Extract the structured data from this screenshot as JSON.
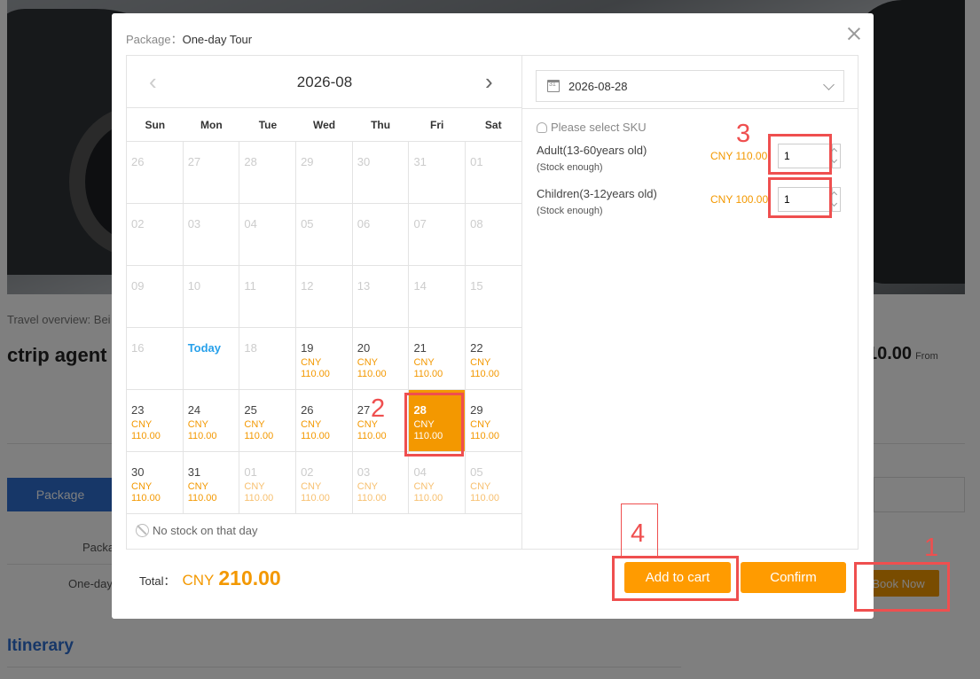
{
  "background": {
    "overview_text": "Travel overview: Bei",
    "title": "ctrip agent",
    "price": "10.00",
    "price_from": "From",
    "package_tab": "Package",
    "col_header": "Packa",
    "row_text": "One-day",
    "book_now": "Book Now",
    "itinerary": "Itinerary"
  },
  "modal": {
    "package_label": "Package：",
    "package_name": "One-day Tour",
    "calendar": {
      "month": "2026-08",
      "weekdays": [
        "Sun",
        "Mon",
        "Tue",
        "Wed",
        "Thu",
        "Fri",
        "Sat"
      ],
      "days": [
        {
          "d": "26",
          "p": ""
        },
        {
          "d": "27",
          "p": ""
        },
        {
          "d": "28",
          "p": ""
        },
        {
          "d": "29",
          "p": ""
        },
        {
          "d": "30",
          "p": ""
        },
        {
          "d": "31",
          "p": ""
        },
        {
          "d": "01",
          "p": ""
        },
        {
          "d": "02",
          "p": ""
        },
        {
          "d": "03",
          "p": ""
        },
        {
          "d": "04",
          "p": ""
        },
        {
          "d": "05",
          "p": ""
        },
        {
          "d": "06",
          "p": ""
        },
        {
          "d": "07",
          "p": ""
        },
        {
          "d": "08",
          "p": ""
        },
        {
          "d": "09",
          "p": ""
        },
        {
          "d": "10",
          "p": ""
        },
        {
          "d": "11",
          "p": ""
        },
        {
          "d": "12",
          "p": ""
        },
        {
          "d": "13",
          "p": ""
        },
        {
          "d": "14",
          "p": ""
        },
        {
          "d": "15",
          "p": ""
        },
        {
          "d": "16",
          "p": ""
        },
        {
          "d": "Today",
          "p": "",
          "state": "today"
        },
        {
          "d": "18",
          "p": ""
        },
        {
          "d": "19",
          "p": "CNY 110.00",
          "state": "avail"
        },
        {
          "d": "20",
          "p": "CNY 110.00",
          "state": "avail"
        },
        {
          "d": "21",
          "p": "CNY 110.00",
          "state": "avail"
        },
        {
          "d": "22",
          "p": "CNY 110.00",
          "state": "avail"
        },
        {
          "d": "23",
          "p": "CNY 110.00",
          "state": "avail"
        },
        {
          "d": "24",
          "p": "CNY 110.00",
          "state": "avail"
        },
        {
          "d": "25",
          "p": "CNY 110.00",
          "state": "avail"
        },
        {
          "d": "26",
          "p": "CNY 110.00",
          "state": "avail"
        },
        {
          "d": "27",
          "p": "CNY 110.00",
          "state": "avail"
        },
        {
          "d": "28",
          "p": "CNY 110.00",
          "state": "sel"
        },
        {
          "d": "29",
          "p": "CNY 110.00",
          "state": "avail"
        },
        {
          "d": "30",
          "p": "CNY 110.00",
          "state": "avail"
        },
        {
          "d": "31",
          "p": "CNY 110.00",
          "state": "avail"
        },
        {
          "d": "01",
          "p": "CNY 110.00",
          "state": "dim"
        },
        {
          "d": "02",
          "p": "CNY 110.00",
          "state": "dim"
        },
        {
          "d": "03",
          "p": "CNY 110.00",
          "state": "dim"
        },
        {
          "d": "04",
          "p": "CNY 110.00",
          "state": "dim"
        },
        {
          "d": "05",
          "p": "CNY 110.00",
          "state": "dim"
        }
      ],
      "legend": "No stock on that day"
    },
    "selected_date": "2026-08-28",
    "sku_hint": "Please select SKU",
    "skus": [
      {
        "name": "Adult(13-60years old)",
        "stock": "(Stock enough)",
        "price": "CNY 110.00",
        "qty": "1"
      },
      {
        "name": "Children(3-12years old)",
        "stock": "(Stock enough)",
        "price": "CNY 100.00",
        "qty": "1"
      }
    ],
    "total_label": "Total：",
    "total_currency": "CNY",
    "total_amount": "210.00",
    "add_to_cart": "Add to cart",
    "confirm": "Confirm"
  },
  "annotations": [
    "1",
    "2",
    "3",
    "4"
  ],
  "colors": {
    "accent": "#ff9b00",
    "link": "#27a0ea",
    "annotation": "#ef4f4f",
    "brand_blue": "#2e6fd0"
  }
}
